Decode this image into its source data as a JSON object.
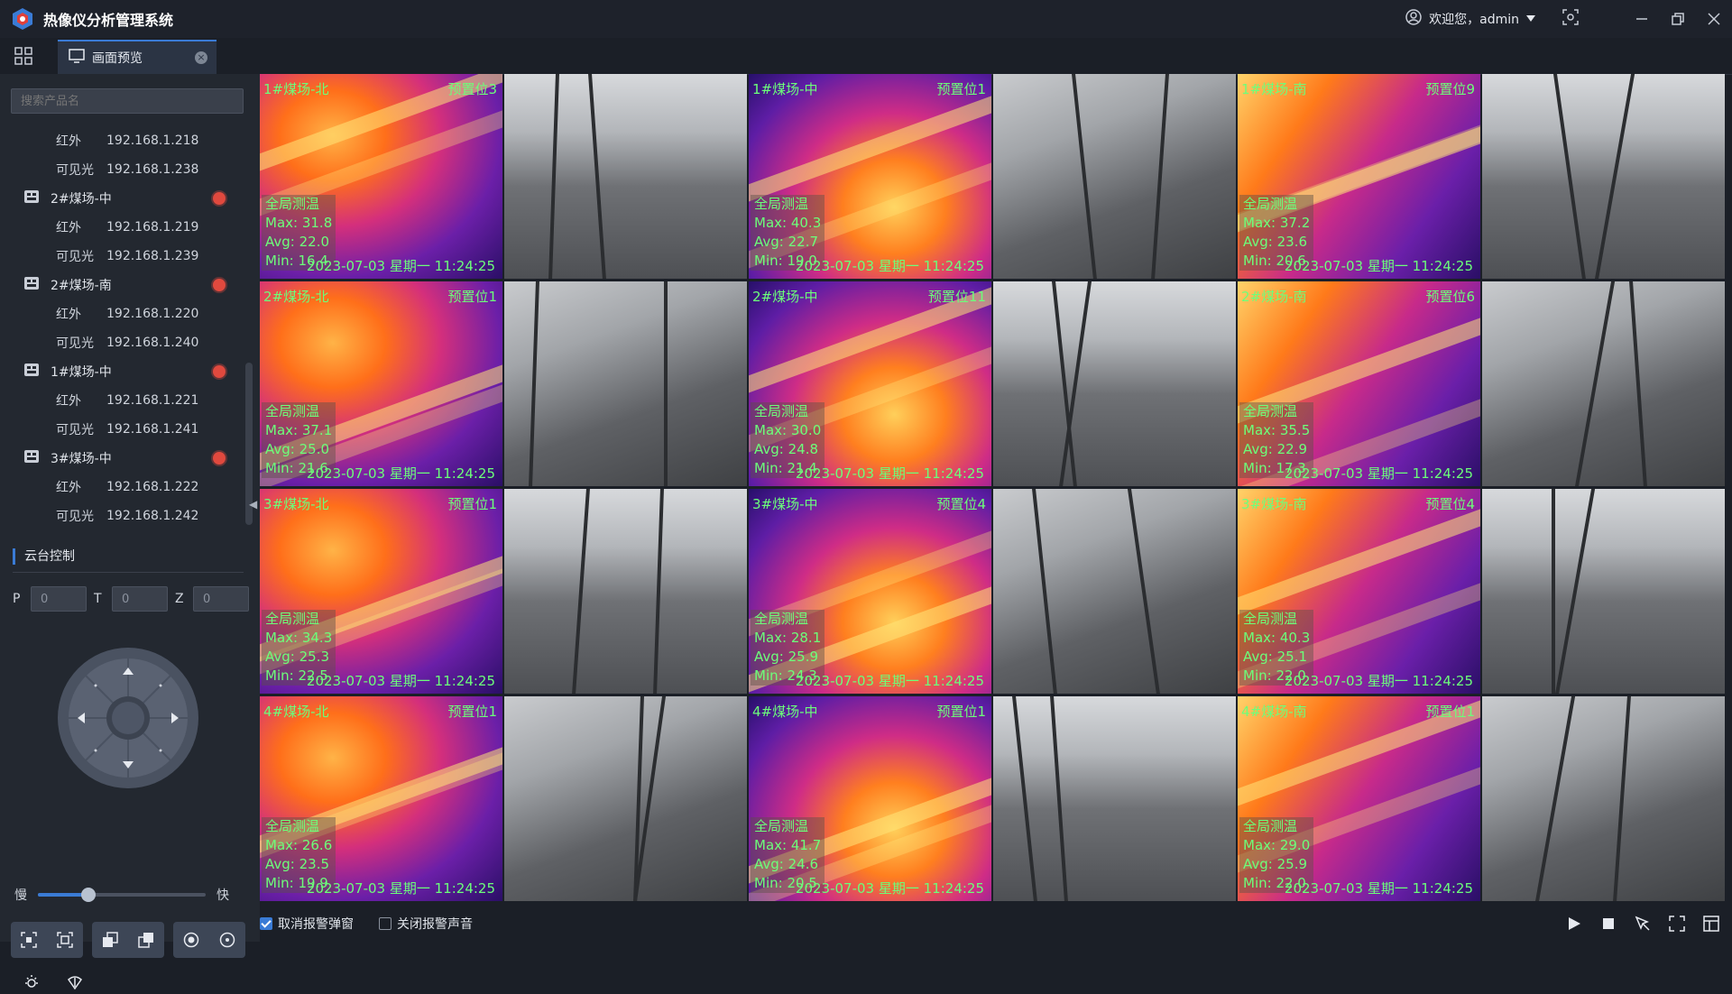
{
  "app": {
    "title": "热像仪分析管理系统"
  },
  "user": {
    "greeting": "欢迎您，admin"
  },
  "tab": {
    "label": "画面预览"
  },
  "sidebar": {
    "search_placeholder": "搜索产品名",
    "tree": [
      {
        "type": "channel",
        "label": "红外",
        "ip": "192.168.1.218"
      },
      {
        "type": "channel",
        "label": "可见光",
        "ip": "192.168.1.238"
      },
      {
        "type": "group",
        "label": "2#煤场-中"
      },
      {
        "type": "channel",
        "label": "红外",
        "ip": "192.168.1.219"
      },
      {
        "type": "channel",
        "label": "可见光",
        "ip": "192.168.1.239"
      },
      {
        "type": "group",
        "label": "2#煤场-南"
      },
      {
        "type": "channel",
        "label": "红外",
        "ip": "192.168.1.220"
      },
      {
        "type": "channel",
        "label": "可见光",
        "ip": "192.168.1.240"
      },
      {
        "type": "group",
        "label": "1#煤场-中"
      },
      {
        "type": "channel",
        "label": "红外",
        "ip": "192.168.1.221"
      },
      {
        "type": "channel",
        "label": "可见光",
        "ip": "192.168.1.241"
      },
      {
        "type": "group",
        "label": "3#煤场-中"
      },
      {
        "type": "channel",
        "label": "红外",
        "ip": "192.168.1.222"
      },
      {
        "type": "channel",
        "label": "可见光",
        "ip": "192.168.1.242"
      }
    ],
    "ptz": {
      "title": "云台控制",
      "p_label": "P",
      "p_value": "0",
      "t_label": "T",
      "t_value": "0",
      "z_label": "Z",
      "z_value": "0",
      "slow_label": "慢",
      "fast_label": "快",
      "speed_fraction": 0.3
    }
  },
  "cameras": [
    {
      "kind": "ir",
      "name": "1#煤场-北",
      "preset": "预置位3",
      "measure_title": "全局测温",
      "max": "Max: 31.8",
      "avg": "Avg: 22.0",
      "min": "Min: 16.4",
      "ts": "2023-07-03 星期一 11:24:25"
    },
    {
      "kind": "vis"
    },
    {
      "kind": "ir",
      "name": "1#煤场-中",
      "preset": "预置位1",
      "measure_title": "全局测温",
      "max": "Max: 40.3",
      "avg": "Avg: 22.7",
      "min": "Min: 19.0",
      "ts": "2023-07-03 星期一 11:24:25"
    },
    {
      "kind": "vis"
    },
    {
      "kind": "ir",
      "name": "1#煤场-南",
      "preset": "预置位9",
      "measure_title": "全局测温",
      "max": "Max: 37.2",
      "avg": "Avg: 23.6",
      "min": "Min: 20.6",
      "ts": "2023-07-03 星期一 11:24:25"
    },
    {
      "kind": "vis"
    },
    {
      "kind": "ir",
      "name": "2#煤场-北",
      "preset": "预置位1",
      "measure_title": "全局测温",
      "max": "Max: 37.1",
      "avg": "Avg: 25.0",
      "min": "Min: 21.6",
      "ts": "2023-07-03 星期一 11:24:25"
    },
    {
      "kind": "vis"
    },
    {
      "kind": "ir",
      "name": "2#煤场-中",
      "preset": "预置位11",
      "measure_title": "全局测温",
      "max": "Max: 30.0",
      "avg": "Avg: 24.8",
      "min": "Min: 21.4",
      "ts": "2023-07-03 星期一 11:24:25"
    },
    {
      "kind": "vis"
    },
    {
      "kind": "ir",
      "name": "2#煤场-南",
      "preset": "预置位6",
      "measure_title": "全局测温",
      "max": "Max: 35.5",
      "avg": "Avg: 22.9",
      "min": "Min: 17.3",
      "ts": "2023-07-03 星期一 11:24:25"
    },
    {
      "kind": "vis"
    },
    {
      "kind": "ir",
      "name": "3#煤场-北",
      "preset": "预置位1",
      "measure_title": "全局测温",
      "max": "Max: 34.3",
      "avg": "Avg: 25.3",
      "min": "Min: 22.5",
      "ts": "2023-07-03 星期一 11:24:25"
    },
    {
      "kind": "vis"
    },
    {
      "kind": "ir",
      "name": "3#煤场-中",
      "preset": "预置位4",
      "measure_title": "全局测温",
      "max": "Max: 28.1",
      "avg": "Avg: 25.9",
      "min": "Min: 24.3",
      "ts": "2023-07-03 星期一 11:24:25"
    },
    {
      "kind": "vis"
    },
    {
      "kind": "ir",
      "name": "3#煤场-南",
      "preset": "预置位4",
      "measure_title": "全局测温",
      "max": "Max: 40.3",
      "avg": "Avg: 25.1",
      "min": "Min: 22.0",
      "ts": "2023-07-03 星期一 11:24:25"
    },
    {
      "kind": "vis"
    },
    {
      "kind": "ir",
      "name": "4#煤场-北",
      "preset": "预置位1",
      "measure_title": "全局测温",
      "max": "Max: 26.6",
      "avg": "Avg: 23.5",
      "min": "Min: 19.9",
      "ts": "2023-07-03 星期一 11:24:25"
    },
    {
      "kind": "vis"
    },
    {
      "kind": "ir",
      "name": "4#煤场-中",
      "preset": "预置位1",
      "measure_title": "全局测温",
      "max": "Max: 41.7",
      "avg": "Avg: 24.6",
      "min": "Min: 20.5",
      "ts": "2023-07-03 星期一 11:24:25"
    },
    {
      "kind": "vis"
    },
    {
      "kind": "ir",
      "name": "4#煤场-南",
      "preset": "预置位1",
      "measure_title": "全局测温",
      "max": "Max: 29.0",
      "avg": "Avg: 25.9",
      "min": "Min: 22.0",
      "ts": "2023-07-03 星期一 11:24:25"
    },
    {
      "kind": "vis"
    }
  ],
  "bottom": {
    "cancel_popup_label": "取消报警弹窗",
    "cancel_popup_checked": true,
    "mute_label": "关闭报警声音",
    "mute_checked": false
  },
  "colors": {
    "accent": "#3a7bd5",
    "osd_text": "#6cff7a",
    "alarm": "#e0493e"
  }
}
